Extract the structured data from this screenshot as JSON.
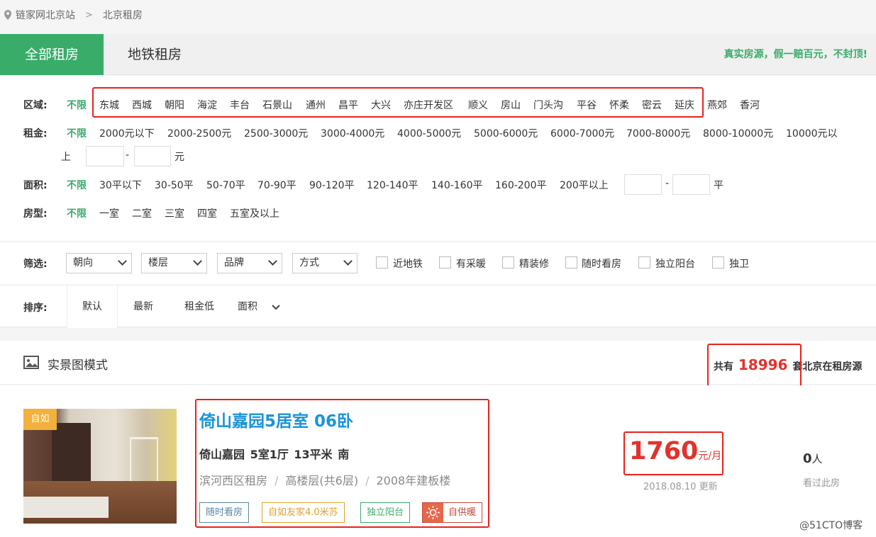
{
  "breadcrumb": {
    "home": "链家网北京站",
    "current": "北京租房",
    "sep": ">"
  },
  "tabs": {
    "all": "全部租房",
    "subway": "地铁租房"
  },
  "slogan": "真实房源，假一赔百元，不封顶!",
  "filters": {
    "area": {
      "label": "区域:",
      "any": "不限",
      "items": [
        "东城",
        "西城",
        "朝阳",
        "海淀",
        "丰台",
        "石景山",
        "通州",
        "昌平",
        "大兴",
        "亦庄开发区",
        "顺义",
        "房山",
        "门头沟",
        "平谷",
        "怀柔",
        "密云",
        "延庆",
        "燕郊",
        "香河"
      ]
    },
    "rent": {
      "label": "租金:",
      "any": "不限",
      "items": [
        "2000元以下",
        "2000-2500元",
        "2500-3000元",
        "3000-4000元",
        "4000-5000元",
        "5000-6000元",
        "6000-7000元",
        "7000-8000元",
        "8000-10000元",
        "10000元以"
      ],
      "wrap": "上",
      "dash": "-",
      "unit": "元"
    },
    "size": {
      "label": "面积:",
      "any": "不限",
      "items": [
        "30平以下",
        "30-50平",
        "50-70平",
        "70-90平",
        "90-120平",
        "120-140平",
        "140-160平",
        "160-200平",
        "200平以上"
      ],
      "dash": "-",
      "unit": "平"
    },
    "layout": {
      "label": "房型:",
      "any": "不限",
      "items": [
        "一室",
        "二室",
        "三室",
        "四室",
        "五室及以上"
      ]
    }
  },
  "screen": {
    "label": "筛选:",
    "selects": [
      "朝向",
      "楼层",
      "品牌",
      "方式"
    ],
    "checks": [
      "近地铁",
      "有采暖",
      "精装修",
      "随时看房",
      "独立阳台",
      "独卫"
    ]
  },
  "sort": {
    "label": "排序:",
    "items": [
      "默认",
      "最新",
      "租金低",
      "面积"
    ]
  },
  "list_head": {
    "mode": "实景图模式",
    "total_prefix": "共有",
    "total": "18996",
    "total_suffix": "套北京在租房源"
  },
  "listing": {
    "photo_tag": "自如",
    "title": "倚山嘉园5居室 06卧",
    "info": "倚山嘉园  5室1厅  13平米  南",
    "meta": [
      "滨河西区租房",
      "高楼层(共6层)",
      "2008年建板楼"
    ],
    "meta_sep": "/",
    "chips": [
      "随时看房",
      "自如友家4.0米苏",
      "独立阳台",
      "自供暖"
    ],
    "price": "1760",
    "price_unit": "元/月",
    "updated": "2018.08.10 更新",
    "viewers": "0",
    "viewers_unit": "人",
    "viewers_label": "看过此房"
  },
  "watermark": "@51CTO博客",
  "colors": {
    "accent": "#39ac6a",
    "title": "#1a94d8",
    "price": "#e2322b",
    "highlight": "#e8221a"
  }
}
